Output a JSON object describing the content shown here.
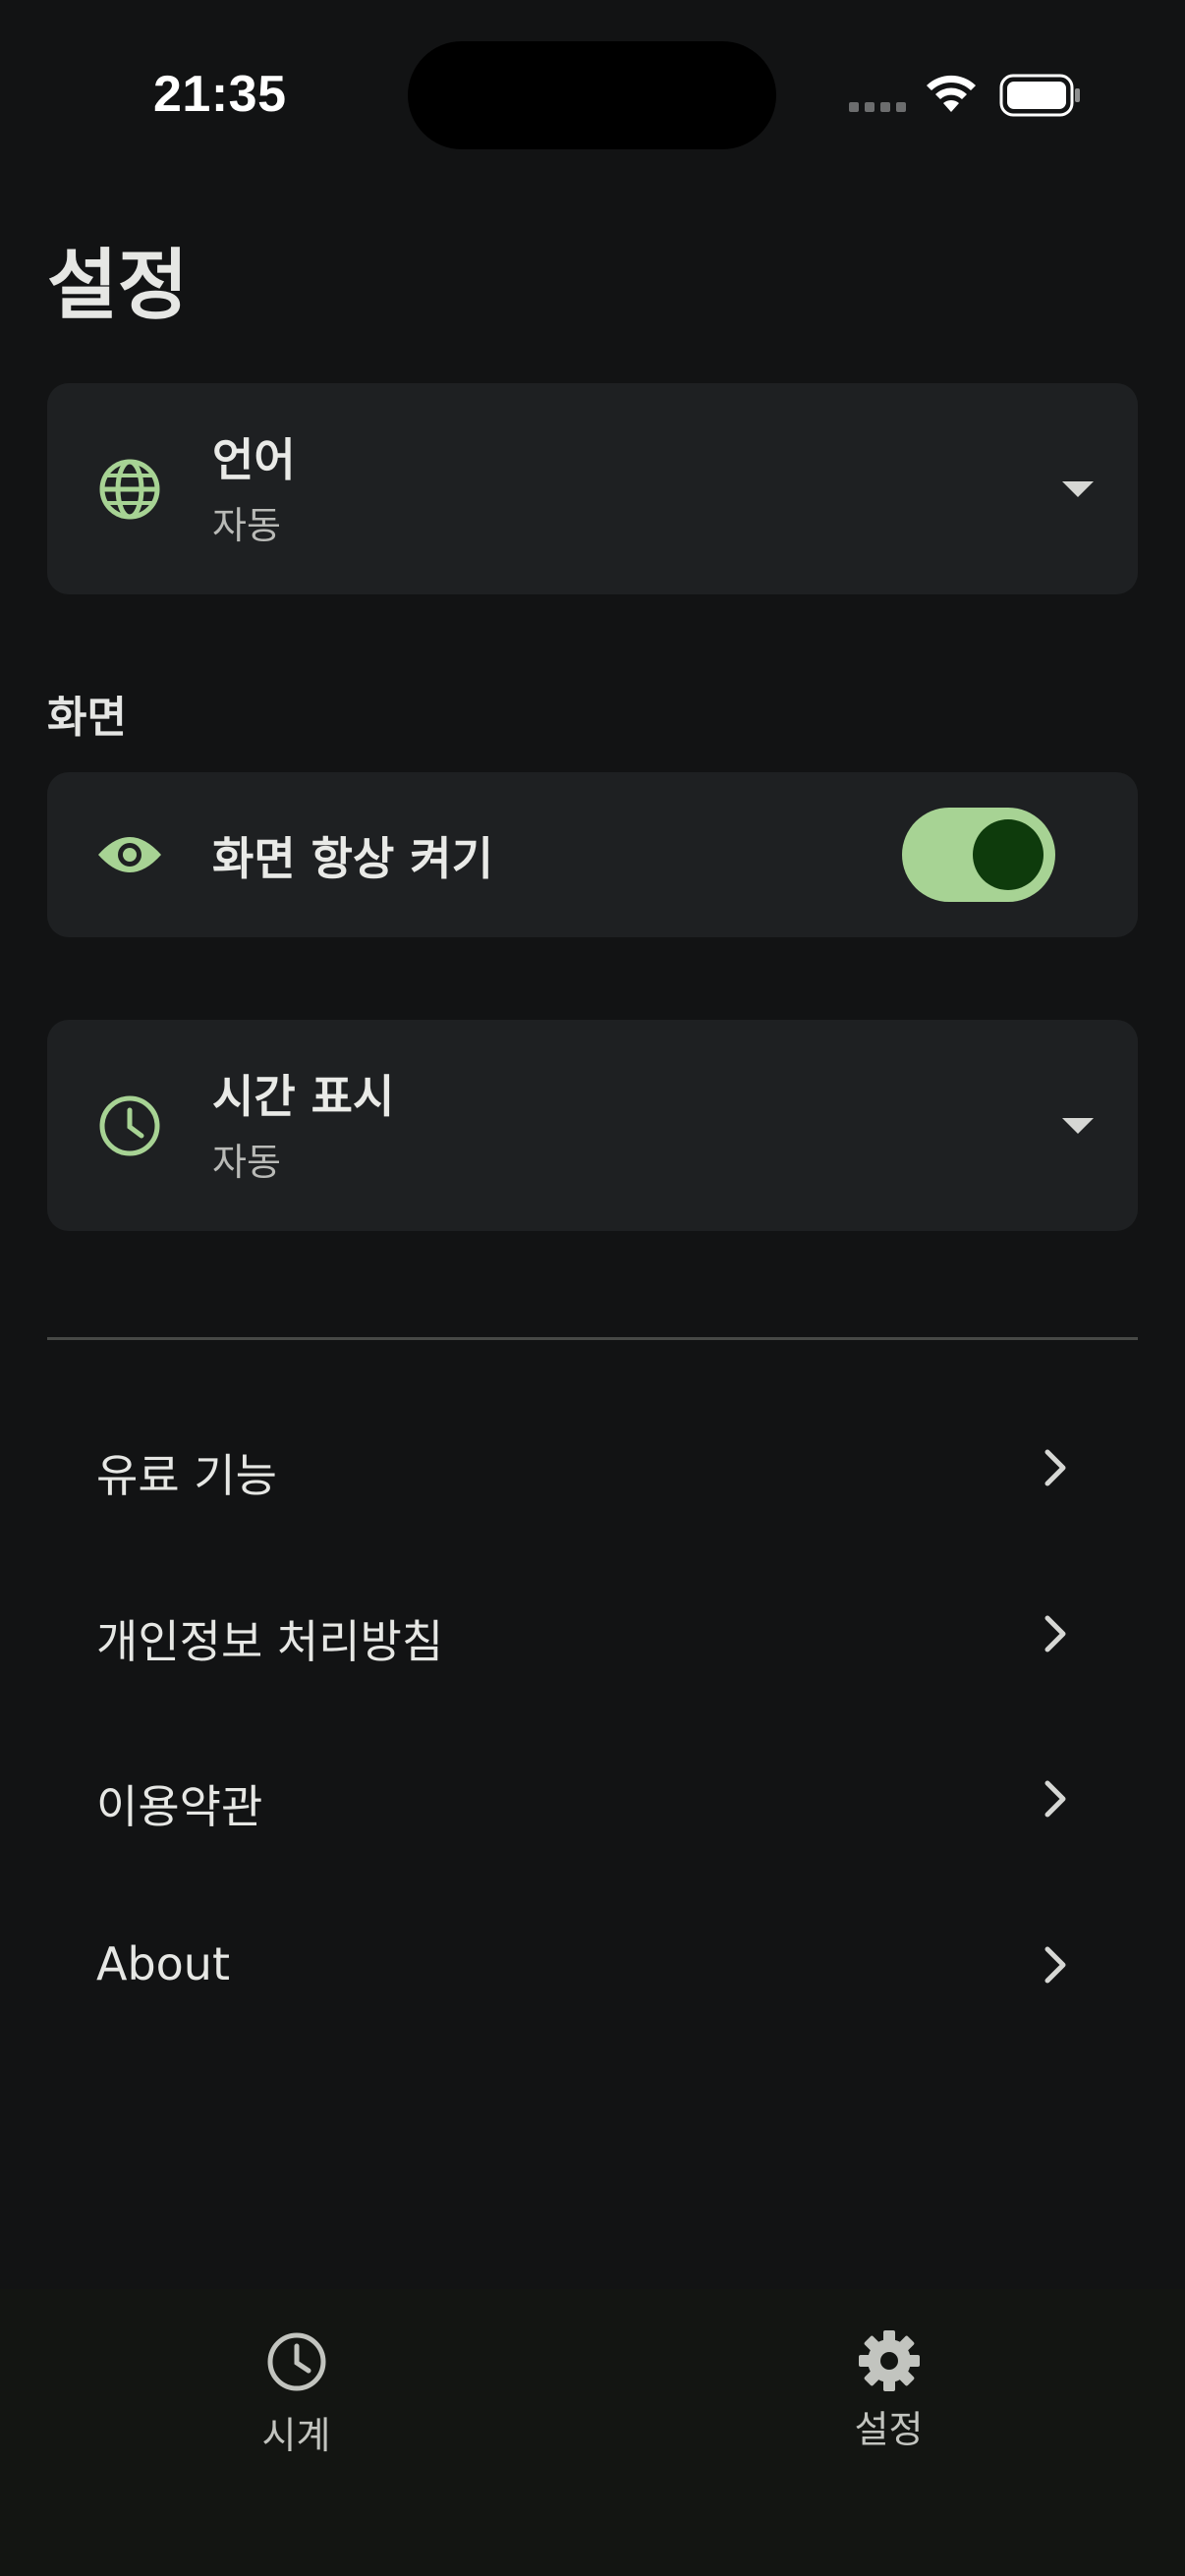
{
  "status_bar": {
    "time": "21:35"
  },
  "page": {
    "title": "설정"
  },
  "language_setting": {
    "icon": "globe-icon",
    "title": "언어",
    "value": "자동"
  },
  "display_section": {
    "header": "화면",
    "keep_screen_on": {
      "icon": "eye-icon",
      "title": "화면 항상 켜기",
      "enabled": true
    }
  },
  "time_display_setting": {
    "icon": "clock-icon",
    "title": "시간 표시",
    "value": "자동"
  },
  "links": [
    {
      "label": "유료 기능"
    },
    {
      "label": "개인정보 처리방침"
    },
    {
      "label": "이용약관"
    },
    {
      "label": "About"
    }
  ],
  "bottom_nav": {
    "items": [
      {
        "label": "시계",
        "icon": "clock-icon",
        "active": false
      },
      {
        "label": "설정",
        "icon": "gear-icon",
        "active": true
      }
    ]
  },
  "colors": {
    "background": "#121314",
    "card": "#1e2022",
    "accent": "#a7d394",
    "toggle_knob": "#0e3b0c"
  }
}
